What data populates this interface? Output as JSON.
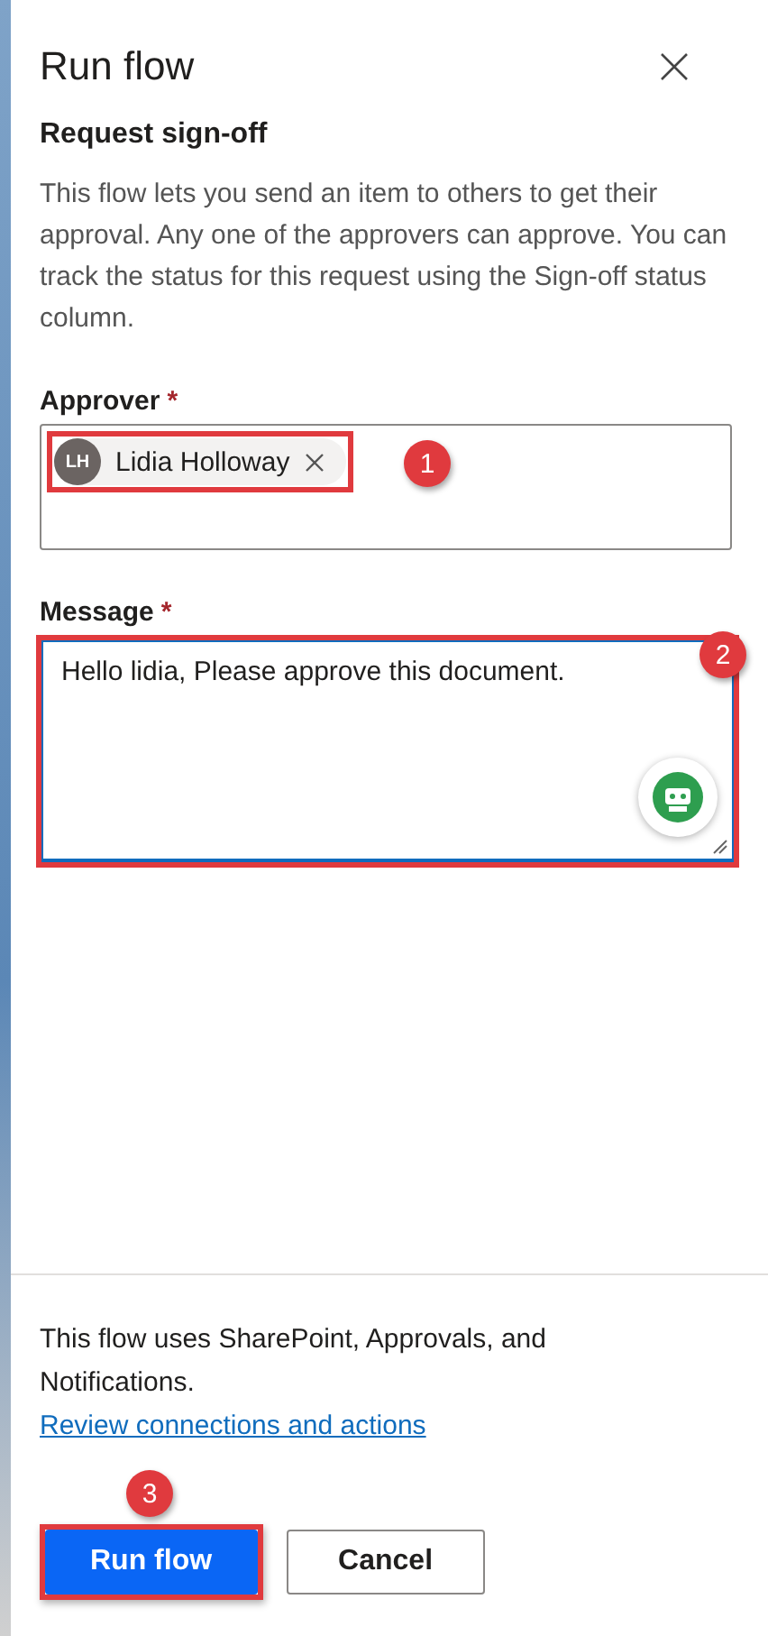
{
  "panel": {
    "title": "Run flow",
    "subtitle": "Request sign-off",
    "description": "This flow lets you send an item to others to get their approval. Any one of the approvers can approve. You can track the status for this request using the Sign-off status column."
  },
  "approver": {
    "label": "Approver",
    "required_mark": "*",
    "highlighted": true,
    "callout": "1",
    "people": [
      {
        "initials": "LH",
        "name": "Lidia Holloway"
      }
    ]
  },
  "message": {
    "label": "Message",
    "required_mark": "*",
    "highlighted": true,
    "callout": "2",
    "value": "Hello lidia, Please approve this document."
  },
  "footer": {
    "note": "This flow uses SharePoint, Approvals, and Notifications.",
    "link": "Review connections and actions"
  },
  "buttons": [
    {
      "label": "Run flow",
      "kind": "primary",
      "highlighted": true,
      "callout": "3"
    },
    {
      "label": "Cancel",
      "kind": "secondary",
      "highlighted": false
    }
  ]
}
